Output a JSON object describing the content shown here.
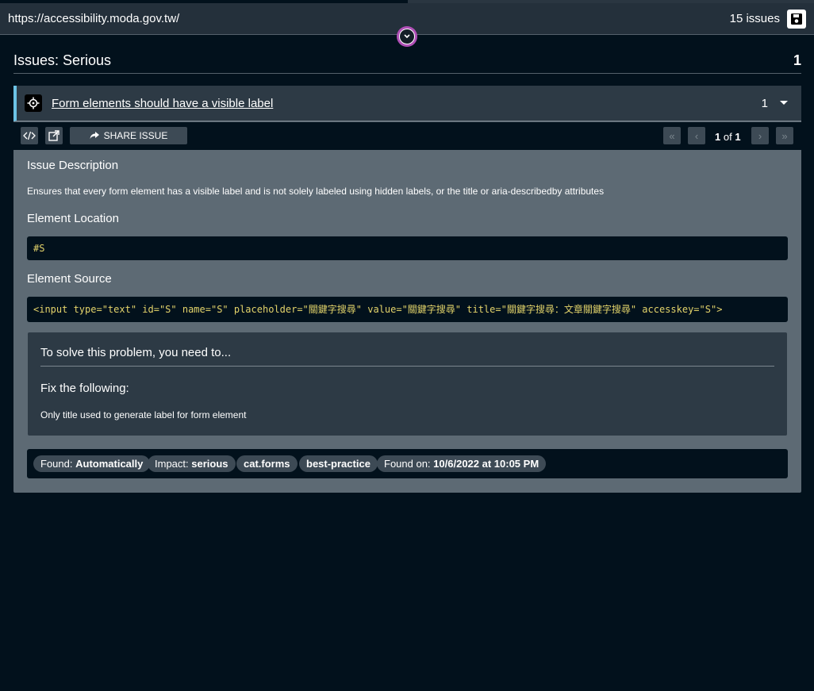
{
  "header": {
    "url": "https://accessibility.moda.gov.tw/",
    "issues_count": "15 issues"
  },
  "section": {
    "title": "Issues: Serious",
    "count": "1"
  },
  "issue": {
    "title": "Form elements should have a visible label",
    "count": "1",
    "toolbar": {
      "share_label": "SHARE ISSUE",
      "pager_current": "1",
      "pager_of": "of",
      "pager_total": "1"
    },
    "description_heading": "Issue Description",
    "description": "Ensures that every form element has a visible label and is not solely labeled using hidden labels, or the title or aria-describedby attributes",
    "location_heading": "Element Location",
    "location": "#S",
    "source_heading": "Element Source",
    "source": "<input type=\"text\" id=\"S\" name=\"S\" placeholder=\"關鍵字搜尋\" value=\"關鍵字搜尋\" title=\"關鍵字搜尋：文章關鍵字搜尋\" accesskey=\"S\">",
    "solve_heading": "To solve this problem, you need to...",
    "fix_heading": "Fix the following:",
    "fix_item": "Only title used to generate label for form element",
    "tags": {
      "found_label": "Found:",
      "found_value": "Automatically",
      "impact_label": "Impact:",
      "impact_value": "serious",
      "cat": "cat.forms",
      "best_practice": "best-practice",
      "found_on_label": "Found on:",
      "found_on_value": "10/6/2022 at 10:05 PM"
    }
  },
  "colors": {
    "background": "#02111c",
    "accent": "#6cc3e6",
    "code_text": "#e3d36a",
    "focus_ring": "#b04fb6"
  }
}
